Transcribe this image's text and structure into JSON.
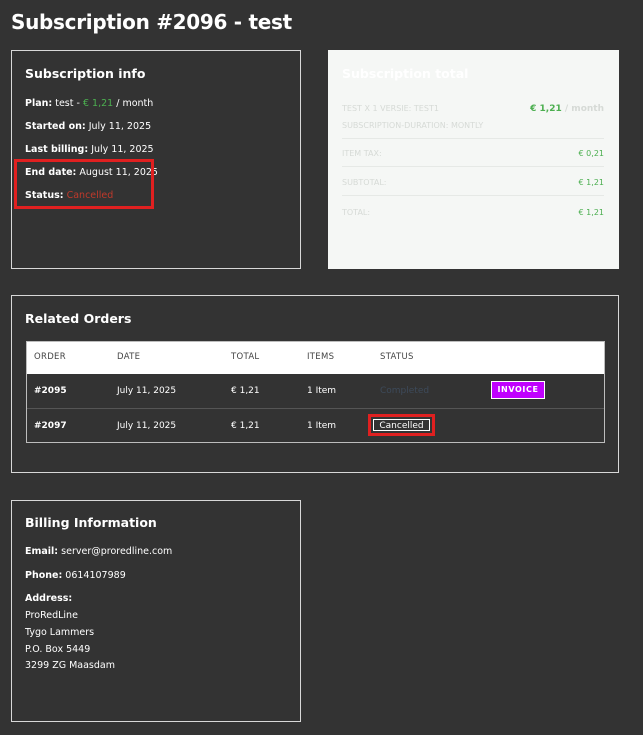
{
  "page": {
    "title": "Subscription #2096 - test"
  },
  "subscription_info": {
    "title": "Subscription info",
    "plan_label": "Plan:",
    "plan_name": "test -",
    "plan_price": "€ 1,21",
    "plan_period": "/ month",
    "started_label": "Started on:",
    "started_value": "July 11, 2025",
    "last_billing_label": "Last billing:",
    "last_billing_value": "July 11, 2025",
    "end_date_label": "End date:",
    "end_date_value": "August 11, 2025",
    "status_label": "Status:",
    "status_value": "Cancelled"
  },
  "subscription_total": {
    "title": "Subscription total",
    "item_line1": "TEST X 1 VERSIE: TEST1",
    "item_line2": "SUBSCRIPTION-DURATION: MONTLY",
    "item_price": "€ 1,21",
    "item_period": "/ month",
    "tax_label": "ITEM TAX:",
    "tax_value": "€ 0,21",
    "subtotal_label": "SUBTOTAL:",
    "subtotal_value": "€ 1,21",
    "total_label": "TOTAL:",
    "total_value": "€ 1,21"
  },
  "related_orders": {
    "title": "Related Orders",
    "columns": [
      "ORDER",
      "DATE",
      "TOTAL",
      "ITEMS",
      "STATUS"
    ],
    "rows": [
      {
        "order": "#2095",
        "date": "July 11, 2025",
        "total": "€ 1,21",
        "items": "1 Item",
        "status": "Completed",
        "action": "INVOICE"
      },
      {
        "order": "#2097",
        "date": "July 11, 2025",
        "total": "€ 1,21",
        "items": "1 Item",
        "status": "Cancelled"
      }
    ]
  },
  "billing": {
    "title": "Billing Information",
    "email_label": "Email:",
    "email_value": "server@proredline.com",
    "phone_label": "Phone:",
    "phone_value": "0614107989",
    "address_label": "Address:",
    "address_lines": [
      "ProRedLine",
      "Tygo Lammers",
      "P.O. Box 5449",
      "3299 ZG Maasdam"
    ]
  },
  "colors": {
    "background": "#333333",
    "accent_green": "#4caf50",
    "invoice_purple": "#c000ff",
    "cancelled_red": "#c0392b",
    "highlight_red": "#e02020"
  }
}
